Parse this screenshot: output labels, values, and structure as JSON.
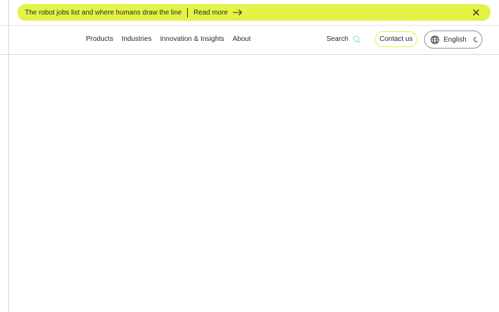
{
  "banner": {
    "text": "The robot jobs list and where humans draw the line",
    "link_label": "Read more",
    "arrow_icon": "arrow-right-icon",
    "close_icon": "close-icon",
    "background": "#e4f347"
  },
  "nav": {
    "items": [
      {
        "label": "Products"
      },
      {
        "label": "Industries"
      },
      {
        "label": "Innovation & Insights"
      },
      {
        "label": "About"
      }
    ]
  },
  "search": {
    "label": "Search",
    "icon": "search-icon"
  },
  "contact": {
    "label": "Contact us",
    "border_color": "#e4f347"
  },
  "language": {
    "label": "English",
    "icon": "globe-icon",
    "loading_icon": "spinner-icon"
  }
}
